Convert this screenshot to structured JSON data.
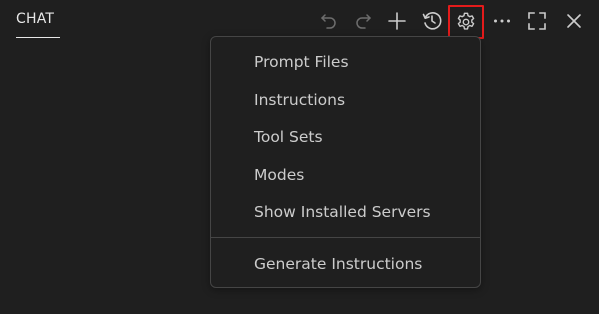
{
  "header": {
    "tab_label": "CHAT"
  },
  "toolbar": {
    "undo_icon": "undo-icon",
    "redo_icon": "redo-icon",
    "new_chat_icon": "plus-icon",
    "history_icon": "history-icon",
    "settings_icon": "gear-icon",
    "more_icon": "ellipsis-icon",
    "maximize_icon": "maximize-icon",
    "close_icon": "close-icon",
    "highlight_color": "#e41b1b"
  },
  "menu": {
    "items": [
      {
        "label": "Prompt Files"
      },
      {
        "label": "Instructions"
      },
      {
        "label": "Tool Sets"
      },
      {
        "label": "Modes"
      },
      {
        "label": "Show Installed Servers"
      }
    ],
    "footer_items": [
      {
        "label": "Generate Instructions"
      }
    ]
  },
  "colors": {
    "background": "#1f1f1f",
    "text": "#cccccc",
    "border": "#454545"
  }
}
